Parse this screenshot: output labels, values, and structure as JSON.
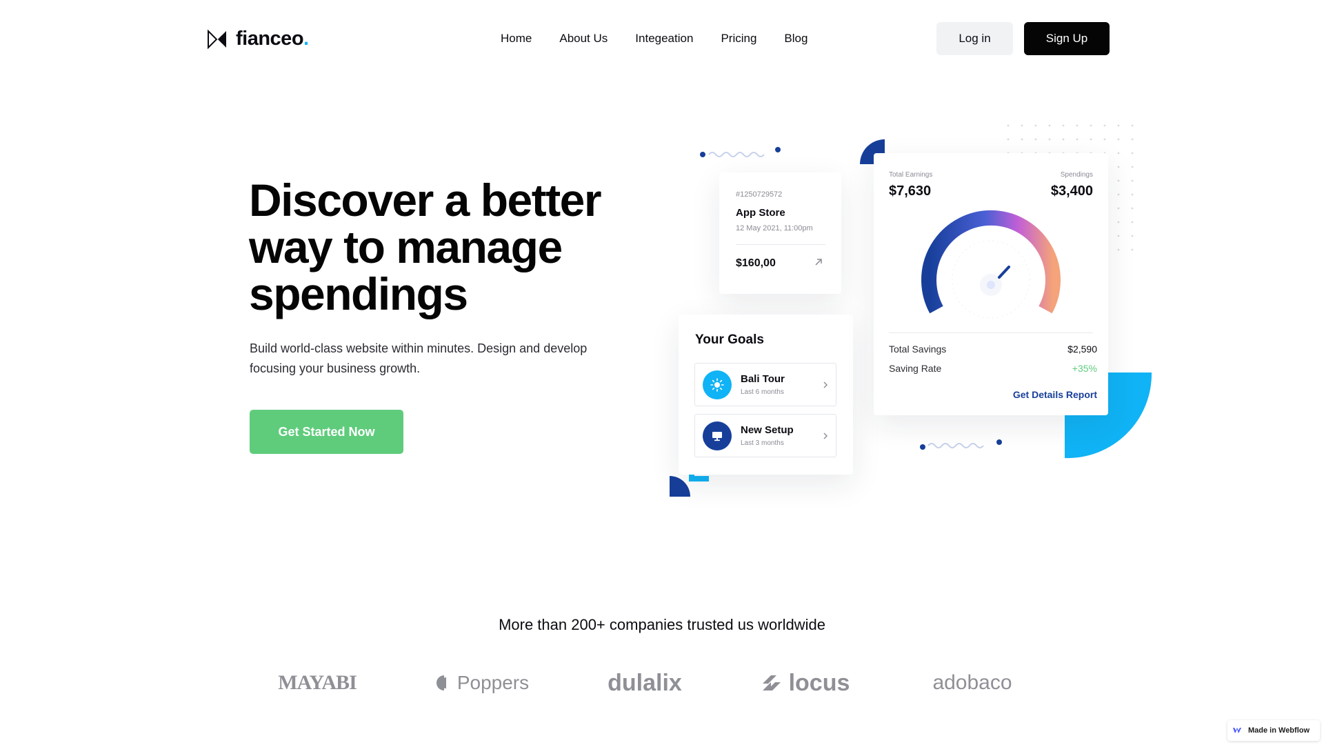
{
  "brand": {
    "name": "fianceo",
    "dot": "."
  },
  "nav": [
    {
      "label": "Home"
    },
    {
      "label": "About Us"
    },
    {
      "label": "Integeation"
    },
    {
      "label": "Pricing"
    },
    {
      "label": "Blog"
    }
  ],
  "auth": {
    "login_label": "Log in",
    "signup_label": "Sign Up"
  },
  "hero": {
    "title": "Discover a better way to manage spendings",
    "subtitle": "Build world-class website within minutes. Design and develop focusing your business growth.",
    "cta_label": "Get Started Now"
  },
  "transaction": {
    "id": "#1250729572",
    "name": "App Store",
    "date": "12 May 2021, 11:00pm",
    "amount": "$160,00"
  },
  "goals": {
    "title": "Your Goals",
    "items": [
      {
        "name": "Bali Tour",
        "period": "Last 6 months",
        "icon": "sun-icon"
      },
      {
        "name": "New Setup",
        "period": "Last 3 months",
        "icon": "monitor-icon"
      }
    ]
  },
  "earnings": {
    "earnings_label": "Total Earnings",
    "earnings_value": "$7,630",
    "spendings_label": "Spendings",
    "spendings_value": "$3,400",
    "savings_label": "Total Savings",
    "savings_value": "$2,590",
    "rate_label": "Saving Rate",
    "rate_value": "+35%",
    "link_label": "Get Details Report"
  },
  "trusted": {
    "heading": "More than 200+ companies trusted us worldwide",
    "logos": [
      "MAYABI",
      "Poppers",
      "dulalix",
      "locus",
      "adobaco"
    ]
  },
  "badge": {
    "label": "Made in Webflow"
  },
  "colors": {
    "accent_green": "#5fcc7c",
    "accent_blue": "#10b3f5",
    "navy": "#173f9a",
    "dark": "#050505"
  }
}
